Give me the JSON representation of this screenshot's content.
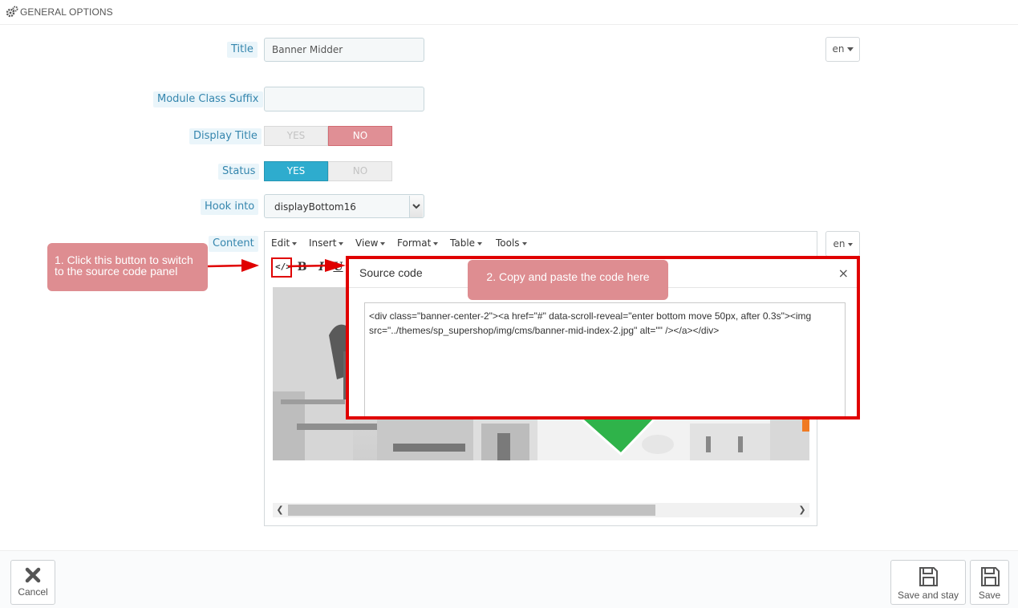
{
  "panel": {
    "heading": "GENERAL OPTIONS"
  },
  "form": {
    "title_label": "Title",
    "title_value": "Banner Midder",
    "language": "en",
    "module_class_suffix_label": "Module Class Suffix",
    "module_class_suffix_value": "",
    "display_title_label": "Display Title",
    "display_title": {
      "yes": "YES",
      "no": "NO",
      "selected": "NO"
    },
    "status_label": "Status",
    "status": {
      "yes": "YES",
      "no": "NO",
      "selected": "YES"
    },
    "hook_into_label": "Hook into",
    "hook_into_value": "displayBottom16",
    "content_label": "Content",
    "content_language": "en"
  },
  "editor": {
    "menu": [
      "Edit",
      "Insert",
      "View",
      "Format",
      "Table",
      "Tools"
    ],
    "toolbar": {
      "source_code": "</>",
      "bold": "B",
      "italic": "I",
      "underline": "U"
    }
  },
  "source_modal": {
    "title": "Source code",
    "close": "×",
    "code": "<div class=\"banner-center-2\"><a href=\"#\" data-scroll-reveal=\"enter bottom move 50px, after 0.3s\"><img src=\"../themes/sp_supershop/img/cms/banner-mid-index-2.jpg\" alt=\"\" /></a></div>"
  },
  "annotations": {
    "step1": "1. Click this button to switch to the source code panel",
    "step2": "2. Copy and paste the code here",
    "accent_color": "#e00000",
    "callout_color": "#de8d91"
  },
  "footer": {
    "cancel": "Cancel",
    "save_and_stay": "Save and stay",
    "save": "Save"
  },
  "icons": {
    "heading": "gears-icon",
    "cancel": "close-icon",
    "save": "floppy-disk-icon"
  }
}
